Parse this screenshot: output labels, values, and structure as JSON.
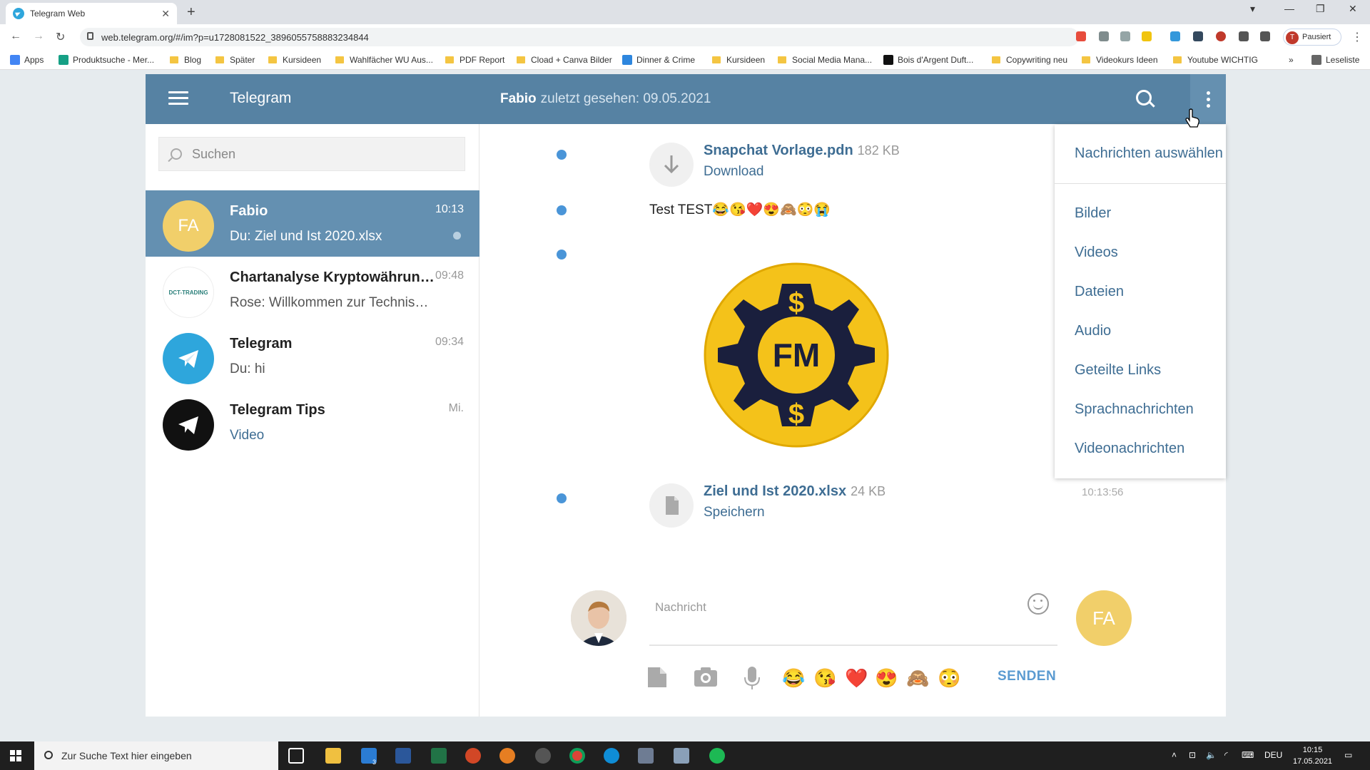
{
  "browser": {
    "tab_title": "Telegram Web",
    "url": "web.telegram.org/#/im?p=u1728081522_3896055758883234844",
    "profile_label": "Pausiert",
    "profile_initial": "T",
    "bookmarks": [
      "Apps",
      "Produktsuche - Mer...",
      "Blog",
      "Später",
      "Kursideen",
      "Wahlfächer WU Aus...",
      "PDF Report",
      "Cload + Canva Bilder",
      "Dinner & Crime",
      "Kursideen",
      "Social Media Mana...",
      "Bois d'Argent Duft...",
      "Copywriting neu",
      "Videokurs Ideen",
      "Youtube WICHTIG"
    ],
    "reading_list": "Leseliste"
  },
  "header": {
    "app_title": "Telegram",
    "peer_name": "Fabio",
    "peer_status": "zuletzt gesehen: 09.05.2021"
  },
  "sidebar": {
    "search_placeholder": "Suchen",
    "dialogs": [
      {
        "initials": "FA",
        "name": "Fabio",
        "message": "Du: Ziel und Ist 2020.xlsx",
        "time": "10:13"
      },
      {
        "initials": "DCT-TRADING",
        "name": "Chartanalyse Kryptowährungen",
        "message": "Rose: Willkommen zur Technischen Analyse",
        "time": "09:48"
      },
      {
        "initials": "",
        "name": "Telegram",
        "message": "Du: hi",
        "time": "09:34"
      },
      {
        "initials": "",
        "name": "Telegram Tips",
        "message": "Video",
        "time": "Mi."
      }
    ]
  },
  "chat": {
    "messages": [
      {
        "file": "Snapchat Vorlage.pdn",
        "size": "182 KB",
        "action": "Download"
      },
      {
        "text": "Test TEST😂😘❤️😍🙈😳😭"
      },
      {
        "sticker_text": "FM"
      },
      {
        "file": "Ziel und Ist 2020.xlsx",
        "size": "24 KB",
        "action": "Speichern",
        "time": "10:13:56"
      }
    ],
    "compose_placeholder": "Nachricht",
    "peer_initials": "FA",
    "send_label": "SENDEN",
    "quick_emojis": [
      "😂",
      "😘",
      "❤️",
      "😍",
      "🙈",
      "😳"
    ]
  },
  "menu": {
    "items": [
      "Nachrichten auswählen",
      "Bilder",
      "Videos",
      "Dateien",
      "Audio",
      "Geteilte Links",
      "Sprachnachrichten",
      "Videonachrichten"
    ]
  },
  "taskbar": {
    "search_placeholder": "Zur Suche Text hier eingeben",
    "language": "DEU",
    "time": "10:15",
    "date": "17.05.2021",
    "mail_badge": "3"
  },
  "colors": {
    "header": "#5682a3",
    "active_dialog": "#6490b1",
    "accent_link": "#3e6d93",
    "avatar_yellow": "#f1cf6a"
  }
}
